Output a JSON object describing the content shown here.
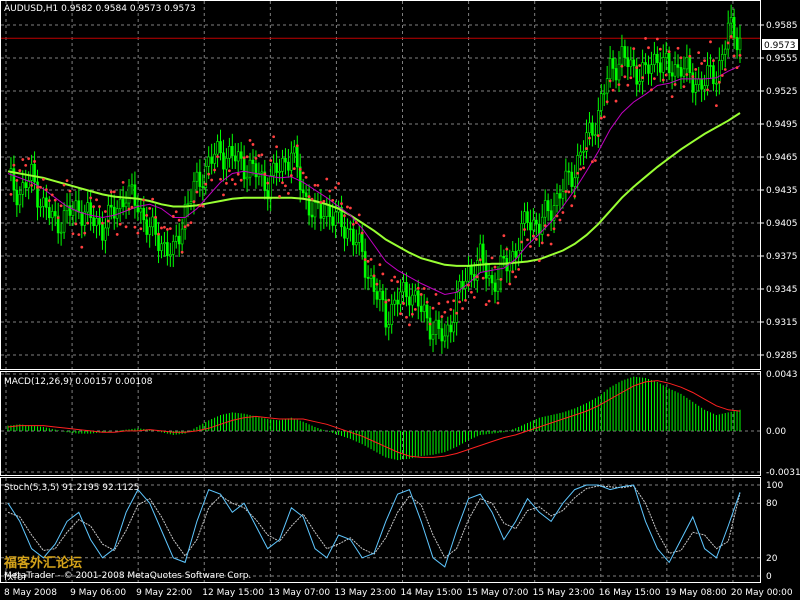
{
  "price_panel": {
    "header": "AUDUSD,H1  0.9582 0.9584 0.9573 0.9573",
    "current_price": 0.9573,
    "current_price_label": "0.9573",
    "y_ticks": [
      "0.9585",
      "0.9555",
      "0.9525",
      "0.9495",
      "0.9465",
      "0.9435",
      "0.9405",
      "0.9375",
      "0.9345",
      "0.9315",
      "0.9285"
    ],
    "colors": {
      "candles": "#00ff00",
      "ma_fast": "#c000c0",
      "ma_slow": "#99ff33",
      "sar": "#ff4040",
      "price_line": "#c00000"
    }
  },
  "macd_panel": {
    "header": "MACD(12,26,9) 0.00157 0.00108",
    "y_ticks": [
      "0.0043",
      "0.00",
      "-0.0031"
    ],
    "colors": {
      "histogram": "#00ff00",
      "signal": "#ff2020"
    }
  },
  "stoch_panel": {
    "header": "Stoch(5,3,5) 91.2195 92.1125",
    "y_ticks": [
      "100",
      "80",
      "20",
      "0"
    ],
    "colors": {
      "main": "#5fc7ff",
      "signal": "#c8c8c8"
    }
  },
  "x_ticks": [
    "8 May 2008",
    "9 May 06:00",
    "9 May 22:00",
    "12 May 15:00",
    "13 May 07:00",
    "13 May 23:00",
    "14 May 15:00",
    "15 May 07:00",
    "15 May 23:00",
    "16 May 15:00",
    "19 May 08:00",
    "20 May 00:00"
  ],
  "watermark": {
    "chinese": "福客外汇论坛",
    "site": "fxfor",
    "credit": "MetaTrader - © 2001-2008 MetaQuotes Software Corp."
  },
  "chart_data": [
    {
      "type": "candlestick",
      "title": "AUDUSD,H1",
      "ylim": [
        0.9275,
        0.9595
      ],
      "grid": true,
      "ohlc_close_path": [
        0.9445,
        0.9432,
        0.9447,
        0.942,
        0.9405,
        0.9412,
        0.942,
        0.9408,
        0.9402,
        0.9415,
        0.9432,
        0.9422,
        0.9398,
        0.9388,
        0.9375,
        0.9418,
        0.944,
        0.946,
        0.947,
        0.9465,
        0.9458,
        0.945,
        0.944,
        0.9455,
        0.947,
        0.9432,
        0.9412,
        0.9418,
        0.9405,
        0.9398,
        0.9375,
        0.9345,
        0.932,
        0.9335,
        0.9345,
        0.9325,
        0.931,
        0.9298,
        0.9335,
        0.936,
        0.9372,
        0.935,
        0.9365,
        0.938,
        0.941,
        0.9402,
        0.942,
        0.9435,
        0.9455,
        0.948,
        0.9505,
        0.9545,
        0.9555,
        0.9545,
        0.954,
        0.9558,
        0.9542,
        0.955,
        0.9532,
        0.9535,
        0.954,
        0.958,
        0.9573
      ],
      "ma_fast": [
        0.945,
        0.9446,
        0.9442,
        0.9436,
        0.9428,
        0.942,
        0.9415,
        0.9412,
        0.941,
        0.9412,
        0.9416,
        0.942,
        0.9422,
        0.9418,
        0.941,
        0.941,
        0.9418,
        0.943,
        0.9442,
        0.945,
        0.9452,
        0.945,
        0.9448,
        0.9446,
        0.9447,
        0.9442,
        0.9435,
        0.9428,
        0.942,
        0.9412,
        0.94,
        0.9385,
        0.937,
        0.9362,
        0.9356,
        0.935,
        0.9345,
        0.934,
        0.9342,
        0.935,
        0.936,
        0.9362,
        0.9364,
        0.9372,
        0.9385,
        0.9395,
        0.9406,
        0.942,
        0.9435,
        0.9452,
        0.947,
        0.949,
        0.9505,
        0.9515,
        0.9522,
        0.953,
        0.9532,
        0.9536,
        0.9536,
        0.9536,
        0.9537,
        0.9543,
        0.9548
      ],
      "ma_slow": [
        0.9452,
        0.945,
        0.9448,
        0.9446,
        0.9443,
        0.944,
        0.9437,
        0.9434,
        0.9431,
        0.9429,
        0.9428,
        0.9427,
        0.9425,
        0.9422,
        0.942,
        0.942,
        0.9421,
        0.9423,
        0.9425,
        0.9427,
        0.9428,
        0.9428,
        0.9428,
        0.9428,
        0.9428,
        0.9427,
        0.9425,
        0.9422,
        0.9418,
        0.9412,
        0.9405,
        0.9398,
        0.939,
        0.9384,
        0.9378,
        0.9373,
        0.937,
        0.9367,
        0.9366,
        0.9366,
        0.9367,
        0.9368,
        0.9368,
        0.9369,
        0.937,
        0.9372,
        0.9376,
        0.938,
        0.9386,
        0.9394,
        0.9404,
        0.9416,
        0.9428,
        0.9438,
        0.9447,
        0.9456,
        0.9464,
        0.9472,
        0.9479,
        0.9486,
        0.9492,
        0.9498,
        0.9505
      ],
      "current_price": 0.9573
    },
    {
      "type": "bar",
      "title": "MACD(12,26,9)",
      "ylim": [
        -0.0031,
        0.0043
      ],
      "macd_histogram": [
        0.0004,
        0.0005,
        0.0004,
        0.0003,
        0.0001,
        -0.0001,
        -0.0002,
        -0.0002,
        -0.0001,
        0.0,
        0.0001,
        0.0002,
        0.0001,
        -0.0001,
        -0.0003,
        -0.0002,
        0.0003,
        0.0008,
        0.0012,
        0.0014,
        0.0013,
        0.0011,
        0.0009,
        0.0008,
        0.001,
        0.0007,
        0.0003,
        0.0,
        -0.0003,
        -0.0006,
        -0.001,
        -0.0015,
        -0.002,
        -0.0022,
        -0.0021,
        -0.0019,
        -0.0018,
        -0.0016,
        -0.0012,
        -0.0007,
        -0.0003,
        -0.0002,
        -0.0001,
        0.0002,
        0.0006,
        0.001,
        0.0012,
        0.0014,
        0.0017,
        0.0021,
        0.0026,
        0.0033,
        0.0038,
        0.0041,
        0.004,
        0.0037,
        0.0032,
        0.0028,
        0.0022,
        0.0016,
        0.0012,
        0.0014,
        0.0016
      ],
      "signal": [
        0.0003,
        0.0004,
        0.0004,
        0.0004,
        0.0003,
        0.0002,
        0.0001,
        0.0,
        -0.0001,
        -0.0001,
        0.0,
        0.0,
        0.0001,
        0.0,
        -0.0001,
        -0.0001,
        0.0,
        0.0002,
        0.0005,
        0.0008,
        0.001,
        0.0011,
        0.001,
        0.0009,
        0.0009,
        0.0009,
        0.0007,
        0.0005,
        0.0002,
        -0.0001,
        -0.0004,
        -0.0008,
        -0.0012,
        -0.0016,
        -0.0019,
        -0.002,
        -0.002,
        -0.0019,
        -0.0017,
        -0.0014,
        -0.0011,
        -0.0008,
        -0.0005,
        -0.0003,
        0.0,
        0.0003,
        0.0006,
        0.0009,
        0.0012,
        0.0015,
        0.0019,
        0.0024,
        0.0029,
        0.0034,
        0.0037,
        0.0038,
        0.0036,
        0.0033,
        0.0029,
        0.0024,
        0.0019,
        0.0016,
        0.0015
      ],
      "last_values": [
        0.00157,
        0.00108
      ]
    },
    {
      "type": "line",
      "title": "Stoch(5,3,5)",
      "ylim": [
        0,
        100
      ],
      "levels": [
        80,
        20
      ],
      "main": [
        80,
        60,
        30,
        20,
        35,
        60,
        70,
        40,
        20,
        30,
        70,
        95,
        80,
        50,
        20,
        15,
        60,
        95,
        90,
        70,
        80,
        55,
        30,
        40,
        75,
        65,
        30,
        20,
        45,
        40,
        20,
        25,
        60,
        90,
        95,
        60,
        20,
        10,
        50,
        85,
        90,
        70,
        40,
        60,
        85,
        70,
        60,
        80,
        95,
        100,
        100,
        95,
        98,
        100,
        60,
        30,
        15,
        40,
        65,
        30,
        20,
        55,
        92
      ],
      "signal": [
        70,
        65,
        45,
        28,
        30,
        48,
        62,
        55,
        35,
        28,
        50,
        78,
        85,
        65,
        40,
        22,
        40,
        75,
        88,
        80,
        75,
        62,
        45,
        38,
        55,
        68,
        48,
        30,
        35,
        42,
        30,
        24,
        42,
        70,
        88,
        78,
        45,
        20,
        30,
        62,
        85,
        80,
        58,
        52,
        72,
        76,
        66,
        72,
        86,
        96,
        99,
        98,
        97,
        99,
        80,
        48,
        25,
        28,
        48,
        45,
        30,
        38,
        91
      ]
    }
  ]
}
